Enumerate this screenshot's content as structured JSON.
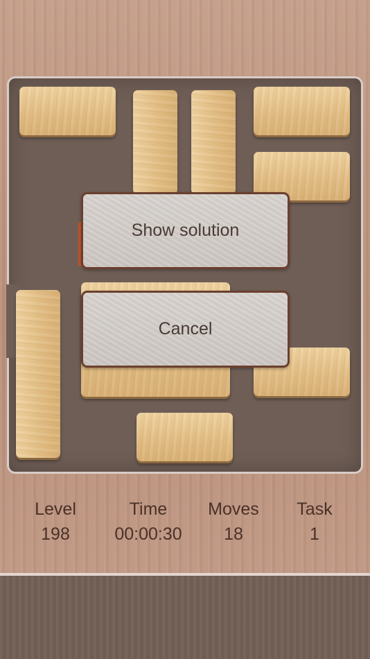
{
  "dialog": {
    "show_solution_label": "Show solution",
    "cancel_label": "Cancel"
  },
  "stats": {
    "level": {
      "label": "Level",
      "value": "198"
    },
    "time": {
      "label": "Time",
      "value": "00:00:30"
    },
    "moves": {
      "label": "Moves",
      "value": "18"
    },
    "task": {
      "label": "Task",
      "value": "1"
    }
  },
  "colors": {
    "board": "#6f5e56",
    "frame": "#d9ccc6",
    "wood_block": "#e3bf86",
    "target_block_edge": "#c0532e",
    "dialog_button": "#d3cec9",
    "dialog_border": "#6b3f2e",
    "text": "#4a3128"
  }
}
